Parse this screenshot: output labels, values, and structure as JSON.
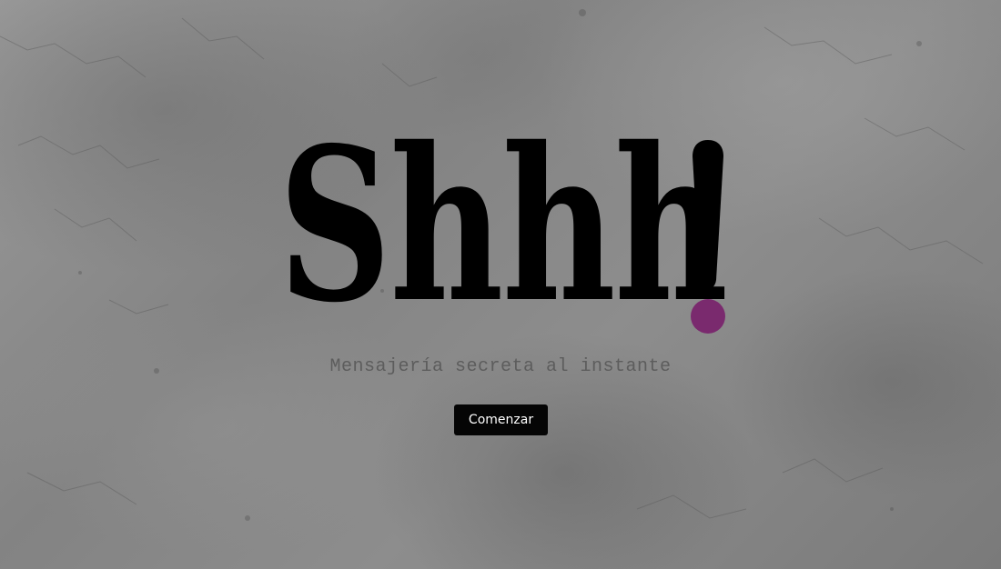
{
  "hero": {
    "logo_text": "Shhh",
    "logo_mark": "!",
    "tagline": "Mensajería secreta al instante",
    "start_label": "Comenzar"
  },
  "colors": {
    "background": "#8f8f8f",
    "logo": "#000000",
    "accent_dot": "#7a2a6e",
    "tagline": "#5d5d5d",
    "button_bg": "#050505",
    "button_text": "#ffffff"
  },
  "icons": {
    "background": "concrete-texture",
    "logo_mark": "exclamation-mark-with-purple-dot"
  }
}
